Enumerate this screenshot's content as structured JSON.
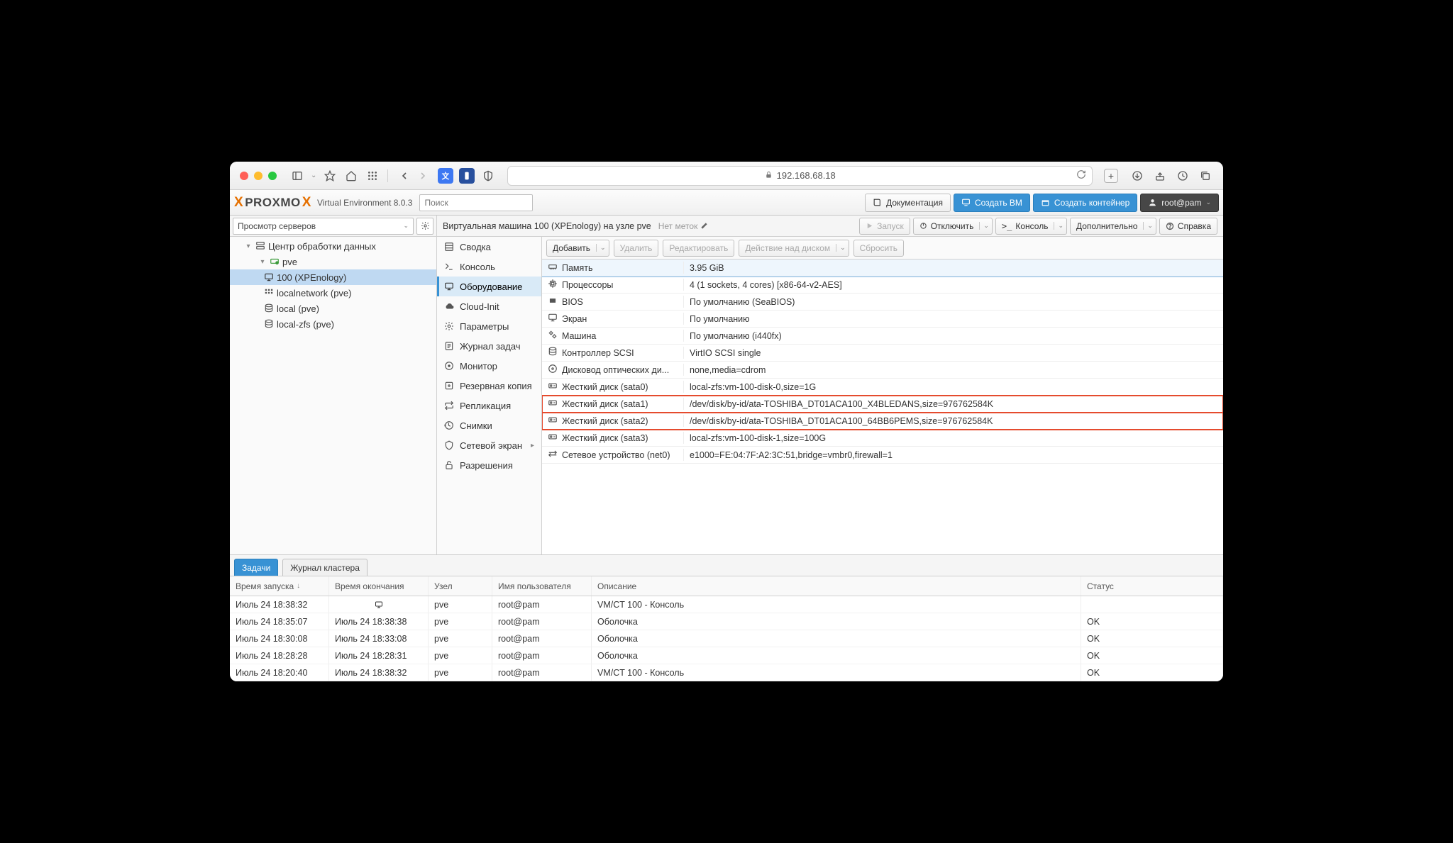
{
  "browser": {
    "url": "192.168.68.18"
  },
  "header": {
    "product": "PROXMO",
    "suffix": "Virtual Environment 8.0.3",
    "search_placeholder": "Поиск",
    "docs": "Документация",
    "create_vm": "Создать ВМ",
    "create_ct": "Создать контейнер",
    "user": "root@pam"
  },
  "tree": {
    "view_label": "Просмотр серверов",
    "items": {
      "dc": "Центр обработки данных",
      "node": "pve",
      "vm": "100 (XPEnology)",
      "net": "localnetwork (pve)",
      "local": "local (pve)",
      "zfs": "local-zfs (pve)"
    }
  },
  "crumb": {
    "title": "Виртуальная машина 100 (XPEnology) на узле pve",
    "tags": "Нет меток",
    "start": "Запуск",
    "shutdown": "Отключить",
    "console": "Консоль",
    "more": "Дополнительно",
    "help": "Справка"
  },
  "sidemenu": {
    "summary": "Сводка",
    "console": "Консоль",
    "hardware": "Оборудование",
    "cloudinit": "Cloud-Init",
    "options": "Параметры",
    "tasklog": "Журнал задач",
    "monitor": "Монитор",
    "backup": "Резервная копия",
    "replication": "Репликация",
    "snapshots": "Снимки",
    "firewall": "Сетевой экран",
    "perms": "Разрешения"
  },
  "hw_toolbar": {
    "add": "Добавить",
    "remove": "Удалить",
    "edit": "Редактировать",
    "diskaction": "Действие над диском",
    "revert": "Сбросить"
  },
  "hardware": [
    {
      "icon": "memory",
      "k": "Память",
      "v": "3.95 GiB",
      "sel": true
    },
    {
      "icon": "cpu",
      "k": "Процессоры",
      "v": "4 (1 sockets, 4 cores) [x86-64-v2-AES]"
    },
    {
      "icon": "chip",
      "k": "BIOS",
      "v": "По умолчанию (SeaBIOS)"
    },
    {
      "icon": "display",
      "k": "Экран",
      "v": "По умолчанию"
    },
    {
      "icon": "cogs",
      "k": "Машина",
      "v": "По умолчанию (i440fx)"
    },
    {
      "icon": "db",
      "k": "Контроллер SCSI",
      "v": "VirtIO SCSI single"
    },
    {
      "icon": "cd",
      "k": "Дисковод оптических ди...",
      "v": "none,media=cdrom"
    },
    {
      "icon": "hdd",
      "k": "Жесткий диск (sata0)",
      "v": "local-zfs:vm-100-disk-0,size=1G"
    },
    {
      "icon": "hdd",
      "k": "Жесткий диск (sata1)",
      "v": "/dev/disk/by-id/ata-TOSHIBA_DT01ACA100_X4BLEDANS,size=976762584K",
      "hl": true
    },
    {
      "icon": "hdd",
      "k": "Жесткий диск (sata2)",
      "v": "/dev/disk/by-id/ata-TOSHIBA_DT01ACA100_64BB6PEMS,size=976762584K",
      "hl": true
    },
    {
      "icon": "hdd",
      "k": "Жесткий диск (sata3)",
      "v": "local-zfs:vm-100-disk-1,size=100G"
    },
    {
      "icon": "net",
      "k": "Сетевое устройство (net0)",
      "v": "e1000=FE:04:7F:A2:3C:51,bridge=vmbr0,firewall=1"
    }
  ],
  "log": {
    "tab_tasks": "Задачи",
    "tab_cluster": "Журнал кластера",
    "cols": {
      "start": "Время запуска",
      "end": "Время окончания",
      "node": "Узел",
      "user": "Имя пользователя",
      "desc": "Описание",
      "status": "Статус"
    },
    "rows": [
      {
        "start": "Июль 24 18:38:32",
        "end": "",
        "running": true,
        "node": "pve",
        "user": "root@pam",
        "desc": "VM/CT 100 - Консоль",
        "status": ""
      },
      {
        "start": "Июль 24 18:35:07",
        "end": "Июль 24 18:38:38",
        "node": "pve",
        "user": "root@pam",
        "desc": "Оболочка",
        "status": "OK"
      },
      {
        "start": "Июль 24 18:30:08",
        "end": "Июль 24 18:33:08",
        "node": "pve",
        "user": "root@pam",
        "desc": "Оболочка",
        "status": "OK"
      },
      {
        "start": "Июль 24 18:28:28",
        "end": "Июль 24 18:28:31",
        "node": "pve",
        "user": "root@pam",
        "desc": "Оболочка",
        "status": "OK"
      },
      {
        "start": "Июль 24 18:20:40",
        "end": "Июль 24 18:38:32",
        "node": "pve",
        "user": "root@pam",
        "desc": "VM/CT 100 - Консоль",
        "status": "OK"
      }
    ]
  }
}
